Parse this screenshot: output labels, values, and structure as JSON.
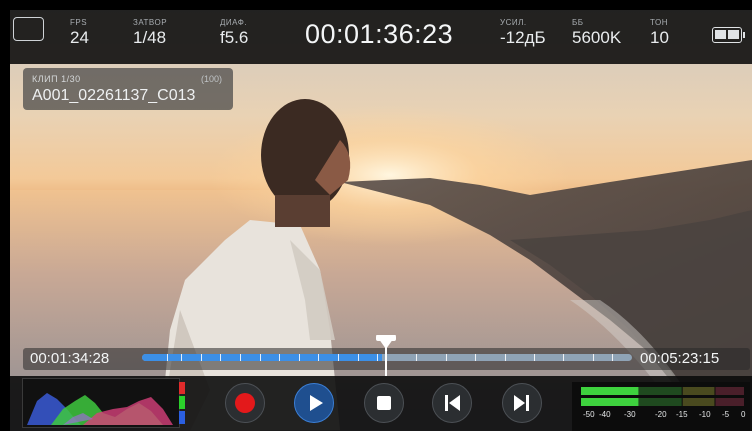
{
  "top_bar": {
    "fps": {
      "label": "FPS",
      "value": "24"
    },
    "shutter": {
      "label": "ЗАТВОР",
      "value": "1/48"
    },
    "aperture": {
      "label": "ДИАФ.",
      "value": "f5.6"
    },
    "timecode": "00:01:36:23",
    "gain": {
      "label": "УСИЛ.",
      "value": "-12дБ"
    },
    "white_balance": {
      "label": "ББ",
      "value": "5600K"
    },
    "tint": {
      "label": "ТОН",
      "value": "10"
    }
  },
  "clip_info": {
    "title": "КЛИП 1/30",
    "count": "(100)",
    "name": "A001_02261137_C013"
  },
  "scrubber": {
    "start_timecode": "00:01:34:28",
    "end_timecode": "00:05:23:15",
    "progress": 0.49,
    "clip_marks": [
      0.05,
      0.08,
      0.12,
      0.16,
      0.2,
      0.24,
      0.28,
      0.32,
      0.36,
      0.4,
      0.44,
      0.48,
      0.56,
      0.62,
      0.68,
      0.74,
      0.8,
      0.86,
      0.92,
      0.96
    ]
  },
  "transport": {
    "buttons": [
      {
        "name": "record-button",
        "icon": "record-icon"
      },
      {
        "name": "play-button",
        "icon": "play-icon"
      },
      {
        "name": "stop-button",
        "icon": "stop-icon"
      },
      {
        "name": "skip-back-button",
        "icon": "skip-back-icon"
      },
      {
        "name": "skip-forward-button",
        "icon": "skip-forward-icon"
      }
    ]
  },
  "audio_meter": {
    "channels": [
      "1",
      "2"
    ],
    "levels": [
      0.35,
      0.35
    ],
    "scale": [
      "-50",
      "-40",
      "-30",
      "-20",
      "-15",
      "-10",
      "-5",
      "0"
    ]
  },
  "colors": {
    "accent_blue": "#3c8fe6",
    "record_red": "#e3191b",
    "meter_green": "#3ed23e"
  }
}
